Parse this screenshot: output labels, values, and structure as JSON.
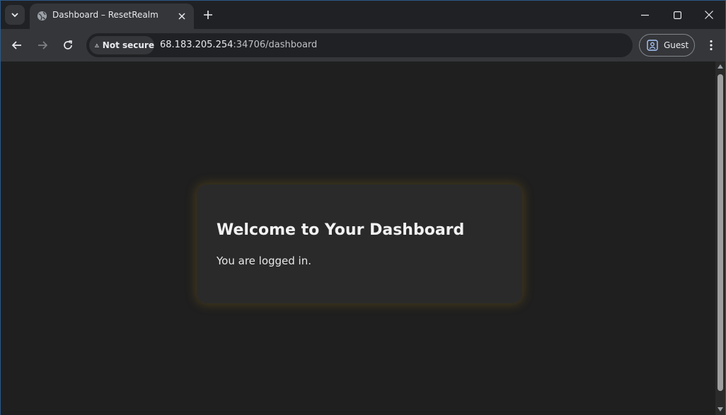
{
  "browser": {
    "tab": {
      "title": "Dashboard – ResetRealm"
    },
    "toolbar": {
      "security_label": "Not secure",
      "url_host": "68.183.205.254",
      "url_rest": ":34706/dashboard",
      "profile_label": "Guest"
    },
    "icons": [
      "tab-search-icon",
      "globe-icon",
      "close-icon",
      "plus-icon",
      "minimize-icon",
      "maximize-icon",
      "window-close-icon",
      "back-arrow-icon",
      "forward-arrow-icon",
      "reload-icon",
      "warning-icon",
      "profile-icon",
      "kebab-menu-icon"
    ]
  },
  "page": {
    "card": {
      "title": "Welcome to Your Dashboard",
      "message": "You are logged in."
    }
  },
  "colors": {
    "background": "#1f1f1f",
    "card": "#2a2a2a",
    "card_glow": "#8c6e14",
    "tabstrip": "#202124",
    "toolbar": "#35363a"
  }
}
